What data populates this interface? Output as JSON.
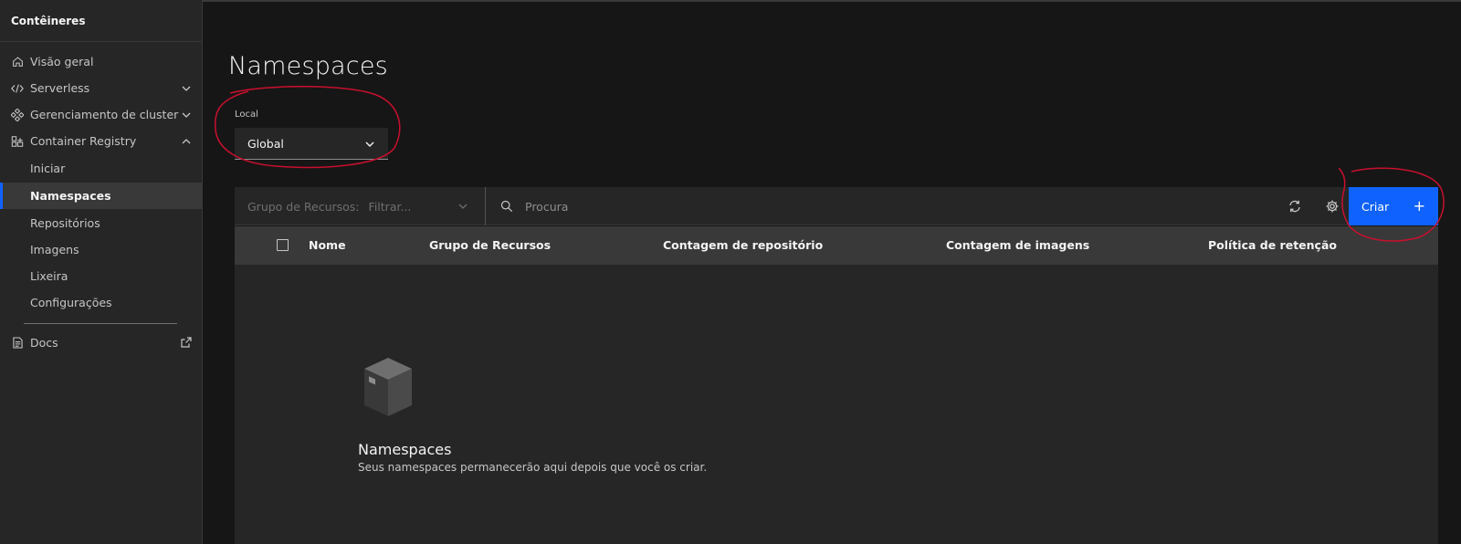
{
  "sidebar": {
    "title": "Contêineres",
    "items": [
      {
        "label": "Visão geral",
        "icon": "home-icon"
      },
      {
        "label": "Serverless",
        "icon": "code-icon",
        "expandable": true
      },
      {
        "label": "Gerenciamento de cluster",
        "icon": "cluster-icon",
        "expandable": true
      },
      {
        "label": "Container Registry",
        "icon": "registry-icon",
        "expanded": true
      }
    ],
    "sub_items": [
      {
        "label": "Iniciar"
      },
      {
        "label": "Namespaces",
        "active": true
      },
      {
        "label": "Repositórios"
      },
      {
        "label": "Imagens"
      },
      {
        "label": "Lixeira"
      },
      {
        "label": "Configurações"
      }
    ],
    "docs": {
      "label": "Docs",
      "icon": "document-icon",
      "external_icon": "launch-icon"
    }
  },
  "page": {
    "title": "Namespaces",
    "local_label": "Local",
    "local_value": "Global"
  },
  "toolbar": {
    "resource_group_label": "Grupo de Recursos:",
    "resource_group_placeholder": "Filtrar...",
    "search_placeholder": "Procura",
    "create_label": "Criar",
    "create_icon": "+"
  },
  "table": {
    "columns": [
      "Nome",
      "Grupo de Recursos",
      "Contagem de repositório",
      "Contagem de imagens",
      "Política de retenção"
    ]
  },
  "empty_state": {
    "title": "Namespaces",
    "description": "Seus namespaces permanecerão aqui depois que você os criar."
  },
  "colors": {
    "accent": "#0f62fe",
    "annotation": "#c8102e"
  }
}
